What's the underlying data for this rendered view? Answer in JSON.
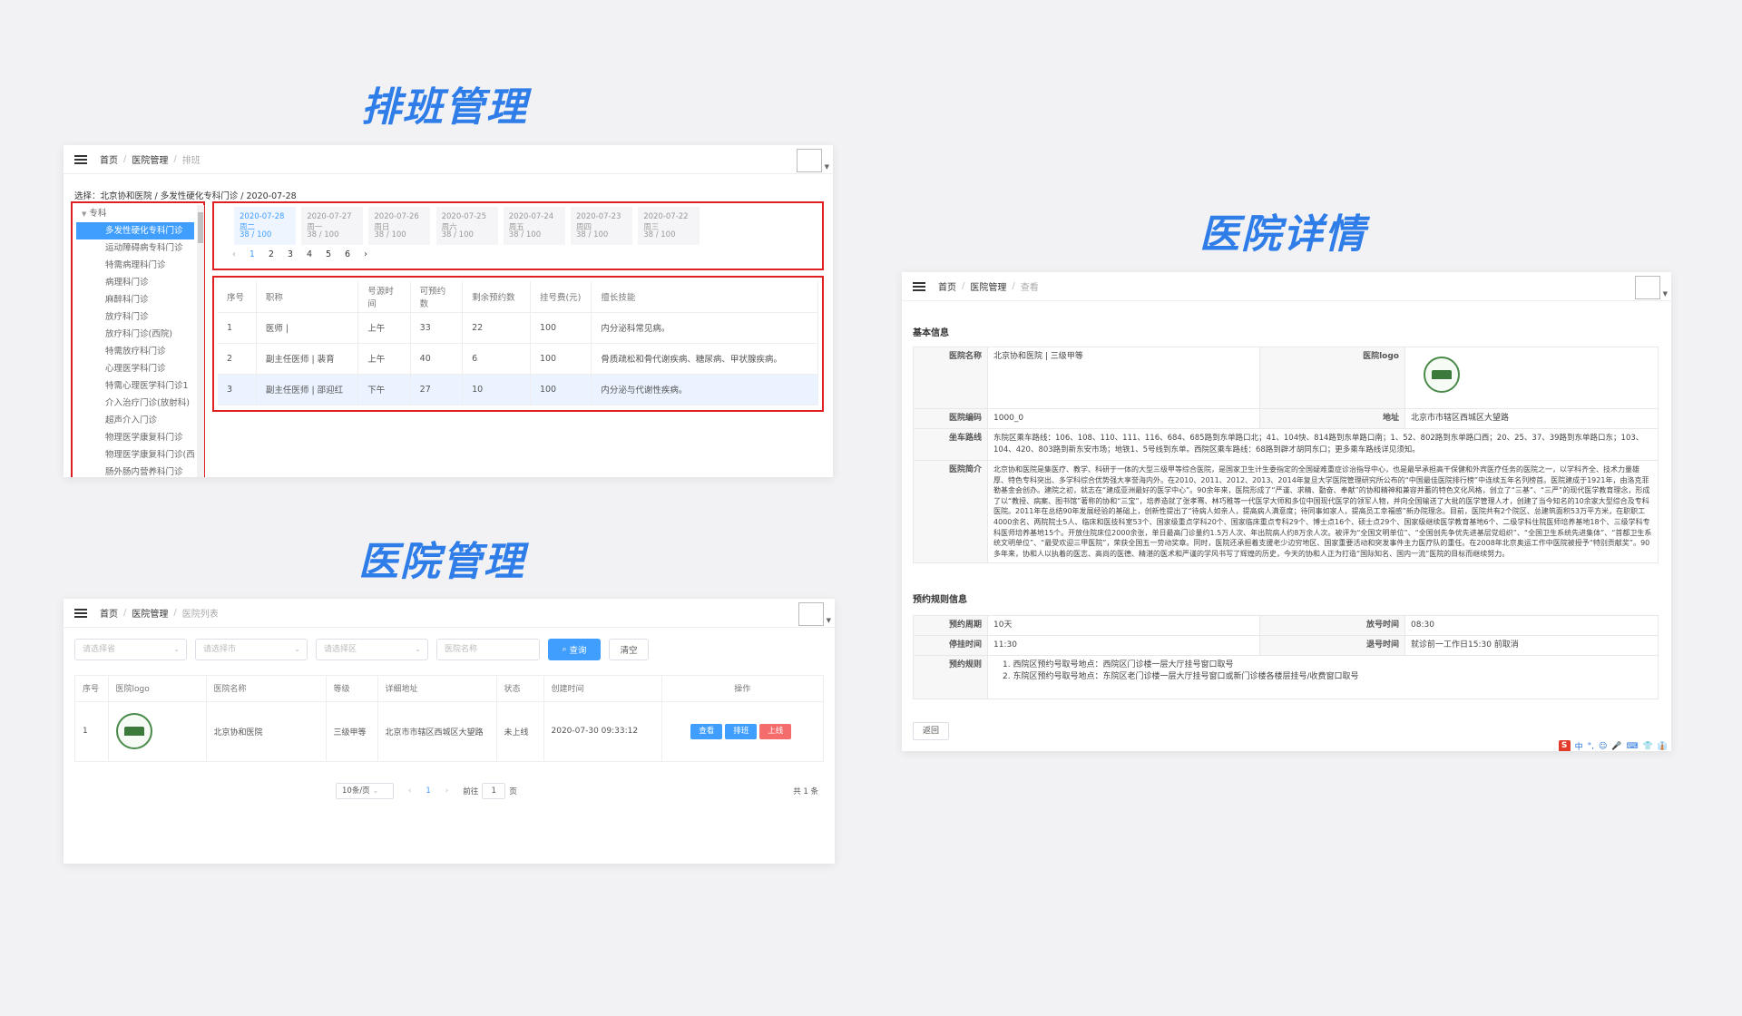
{
  "titles": {
    "schedule": "排班管理",
    "detail": "医院详情",
    "hospital": "医院管理"
  },
  "colors": {
    "accent": "#409eff",
    "title": "#2f7de8",
    "highlight": "#e02020"
  },
  "schedule_panel": {
    "breadcrumb": [
      "首页",
      "医院管理",
      "排班"
    ],
    "selected_path": "选择：北京协和医院 / 多发性硬化专科门诊 / 2020-07-28",
    "tree_root": "专科",
    "tree_items": [
      "多发性硬化专科门诊",
      "运动障碍病专科门诊",
      "特需病理科门诊",
      "病理科门诊",
      "麻醉科门诊",
      "放疗科门诊",
      "放疗科门诊(西院)",
      "特需放疗科门诊",
      "心理医学科门诊",
      "特需心理医学科门诊1",
      "介入治疗门诊(放射科)",
      "超声介入门诊",
      "物理医学康复科门诊",
      "物理医学康复科门诊(西",
      "肠外肠内营养科门诊"
    ],
    "dates": [
      {
        "date": "2020-07-28 周二",
        "count": "38 / 100"
      },
      {
        "date": "2020-07-27 周一",
        "count": "38 / 100"
      },
      {
        "date": "2020-07-26 周日",
        "count": "38 / 100"
      },
      {
        "date": "2020-07-25 周六",
        "count": "38 / 100"
      },
      {
        "date": "2020-07-24 周五",
        "count": "38 / 100"
      },
      {
        "date": "2020-07-23 周四",
        "count": "38 / 100"
      },
      {
        "date": "2020-07-22 周三",
        "count": "38 / 100"
      }
    ],
    "pagination": [
      "‹",
      "1",
      "2",
      "3",
      "4",
      "5",
      "6",
      "›"
    ],
    "table_headers": [
      "序号",
      "职称",
      "号源时间",
      "可预约数",
      "剩余预约数",
      "挂号费(元)",
      "擅长技能"
    ],
    "rows": [
      [
        "1",
        "医师 |",
        "上午",
        "33",
        "22",
        "100",
        "内分泌科常见病。"
      ],
      [
        "2",
        "副主任医师 | 裴育",
        "上午",
        "40",
        "6",
        "100",
        "骨质疏松和骨代谢疾病、糖尿病、甲状腺疾病。"
      ],
      [
        "3",
        "副主任医师 | 邵迎红",
        "下午",
        "27",
        "10",
        "100",
        "内分泌与代谢性疾病。"
      ]
    ]
  },
  "hospital_panel": {
    "breadcrumb": [
      "首页",
      "医院管理",
      "医院列表"
    ],
    "filters": [
      "请选择省",
      "请选择市",
      "请选择区",
      "医院名称"
    ],
    "search_label": "查询",
    "clear_label": "清空",
    "table_headers": [
      "序号",
      "医院logo",
      "医院名称",
      "等级",
      "详细地址",
      "状态",
      "创建时间",
      "操作"
    ],
    "rows": [
      {
        "no": "1",
        "name": "北京协和医院",
        "level": "三级甲等",
        "address": "北京市市辖区西城区大望路",
        "status": "未上线",
        "created": "2020-07-30 09:33:12"
      }
    ],
    "actions": [
      "查看",
      "排班",
      "上线"
    ],
    "page_size": "10条/页",
    "page_prev": "‹",
    "page_current": "1",
    "page_next": "›",
    "goto_label": "前往",
    "goto_value": "1",
    "page_unit": "页",
    "total": "共 1 条"
  },
  "detail_panel": {
    "breadcrumb": [
      "首页",
      "医院管理",
      "查看"
    ],
    "basic_title": "基本信息",
    "labels": {
      "name": "医院名称",
      "logo": "医院logo",
      "code": "医院编码",
      "address": "地址",
      "route": "坐车路线",
      "intro": "医院简介"
    },
    "name": "北京协和医院 | 三级甲等",
    "code": "1000_0",
    "address": "北京市市辖区西城区大望路",
    "route": "东院区乘车路线：106、108、110、111、116、684、685路到东单路口北；41、104快、814路到东单路口南；1、52、802路到东单路口西；20、25、37、39路到东单路口东；103、104、420、803路到新东安市场；地铁1、5号线到东单。西院区乘车路线：68路到辟才胡同东口；更多乘车路线详见须知。",
    "intro": "北京协和医院是集医疗、教学、科研于一体的大型三级甲等综合医院，是国家卫生计生委指定的全国疑难重症诊治指导中心，也是最早承担高干保健和外宾医疗任务的医院之一，以学科齐全、技术力量雄厚、特色专科突出、多学科综合优势强大享誉海内外。在2010、2011、2012、2013、2014年复旦大学医院管理研究所公布的“中国最佳医院排行榜”中连续五年名列榜首。医院建成于1921年，由洛克菲勒基金会创办。建院之初，就志在“建成亚洲最好的医学中心”。90余年来，医院形成了“严谨、求精、勤奋、奉献”的协和精神和兼容并蓄的特色文化风格，创立了“三基”、“三严”的现代医学教育理念，形成了以“教授、病案、图书馆”著称的协和“三宝”，培养造就了张孝骞、林巧稚等一代医学大师和多位中国现代医学的领军人物，并向全国输送了大批的医学管理人才，创建了当今知名的10余家大型综合及专科医院。2011年在总结90年发展经验的基础上，创新性提出了“待病人如亲人，提高病人满意度；待同事如家人，提高员工幸福感”新办院理念。目前，医院共有2个院区、总建筑面积53万平方米，在职职工4000余名、两院院士5人、临床和医技科室53个、国家级重点学科20个、国家临床重点专科29个、博士点16个、硕士点29个、国家级继续医学教育基地6个、二级学科住院医师培养基地18个、三级学科专科医师培养基地15个。开放住院床位2000余张，单日最高门诊量约1.5万人次、年出院病人约8万余人次。被评为“全国文明单位”、“全国创先争优先进基层党组织”、“全国卫生系统先进集体”、“首都卫生系统文明单位”、“最受欢迎三甲医院”，荣获全国五一劳动奖章。同时，医院还承担着支援老少边穷地区、国家重要活动和突发事件主力医疗队的重任。在2008年北京奥运工作中医院被授予“特别贡献奖”。90多年来，协和人以执着的医志、高尚的医德、精湛的医术和严谨的学风书写了辉煌的历史，今天的协和人正为打造“国际知名、国内一流”医院的目标而继续努力。",
    "rule_title": "预约规则信息",
    "rule_labels": {
      "cycle": "预约周期",
      "release": "放号时间",
      "stop": "停挂时间",
      "cancel": "退号时间",
      "rule": "预约规则"
    },
    "cycle": "10天",
    "release": "08:30",
    "stop": "11:30",
    "cancel": "就诊前一工作日15:30 前取消",
    "rules": [
      "1. 西院区预约号取号地点：西院区门诊楼一层大厅挂号窗口取号",
      "2. 东院区预约号取号地点：东院区老门诊楼一层大厅挂号窗口或新门诊楼各楼层挂号/收费窗口取号"
    ],
    "back_label": "返回",
    "ime": [
      "S",
      "中",
      "°,",
      "☺",
      "🎤",
      "⌨",
      "👕",
      "👔"
    ]
  }
}
